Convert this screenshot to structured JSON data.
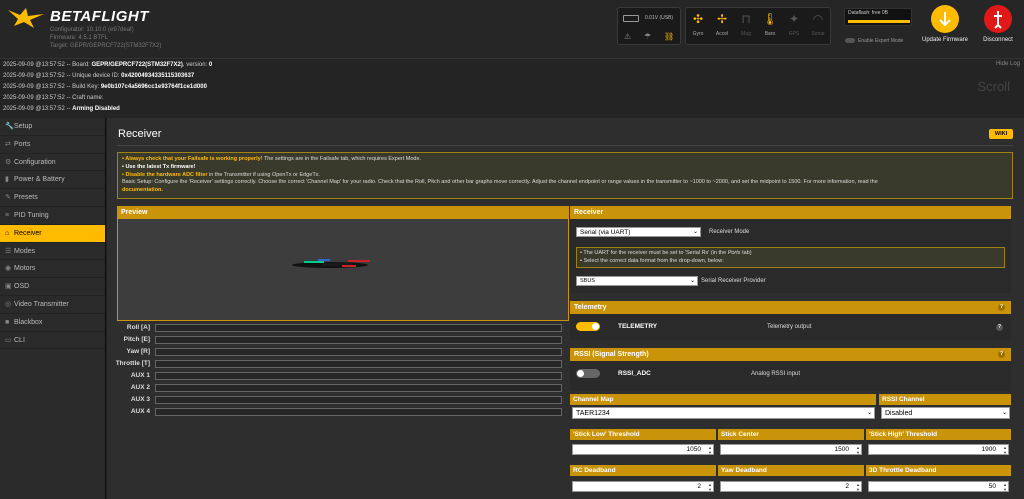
{
  "header": {
    "brand": "BETAFLIGHT",
    "configurator": "Configurator: 10.10.0 (e97deaf)",
    "firmware": "Firmware: 4.5.1 BTFL",
    "target": "Target: GEPR/GEPRCF722(STM32F7X2)",
    "battery_voltage": "0.01V (USB)",
    "sensors": [
      {
        "label": "Gyro",
        "icon": "gyro-icon",
        "active": true
      },
      {
        "label": "Accel",
        "icon": "accel-icon",
        "active": true
      },
      {
        "label": "Mag",
        "icon": "mag-icon",
        "active": false
      },
      {
        "label": "Baro",
        "icon": "baro-icon",
        "active": true
      },
      {
        "label": "GPS",
        "icon": "gps-icon",
        "active": false
      },
      {
        "label": "Sonar",
        "icon": "sonar-icon",
        "active": false
      }
    ],
    "dataflash": "Dataflash: free 0B",
    "expert_mode": "Enable Expert Mode",
    "update_firmware": "Update Firmware",
    "disconnect": "Disconnect",
    "accent": "#ffbb00"
  },
  "log": {
    "hide_label": "Hide Log",
    "scroll_label": "Scroll",
    "lines": [
      {
        "ts": "2025-09-09 @13:57:52",
        "text": " -- Board: ",
        "val": "GEPR/GEPRCF722(STM32F7X2)",
        "tail": ", version: ",
        "tailval": "0"
      },
      {
        "ts": "2025-09-09 @13:57:52",
        "text": " -- Unique device ID: ",
        "val": "0x42004934335115303637",
        "tail": "",
        "tailval": ""
      },
      {
        "ts": "2025-09-09 @13:57:52",
        "text": " -- Build Key: ",
        "val": "9e0b107c4a5696cc1e93764f1ce1d000",
        "tail": "",
        "tailval": ""
      },
      {
        "ts": "2025-09-09 @13:57:52",
        "text": " -- Craft name: ",
        "val": "",
        "tail": "",
        "tailval": ""
      },
      {
        "ts": "2025-09-09 @13:57:52",
        "text": " -- ",
        "val": "Arming Disabled",
        "tail": "",
        "tailval": ""
      }
    ]
  },
  "sidebar": {
    "items": [
      {
        "label": "Setup",
        "icon": "wrench-icon",
        "active": false
      },
      {
        "label": "Ports",
        "icon": "plug-icon",
        "active": false
      },
      {
        "label": "Configuration",
        "icon": "gear-icon",
        "active": false
      },
      {
        "label": "Power & Battery",
        "icon": "battery-icon",
        "active": false
      },
      {
        "label": "Presets",
        "icon": "wand-icon",
        "active": false
      },
      {
        "label": "PID Tuning",
        "icon": "sliders-icon",
        "active": false
      },
      {
        "label": "Receiver",
        "icon": "receiver-icon",
        "active": true
      },
      {
        "label": "Modes",
        "icon": "modes-icon",
        "active": false
      },
      {
        "label": "Motors",
        "icon": "motor-icon",
        "active": false
      },
      {
        "label": "OSD",
        "icon": "osd-icon",
        "active": false
      },
      {
        "label": "Video Transmitter",
        "icon": "vtx-icon",
        "active": false
      },
      {
        "label": "Blackbox",
        "icon": "blackbox-icon",
        "active": false
      },
      {
        "label": "CLI",
        "icon": "terminal-icon",
        "active": false
      }
    ]
  },
  "page": {
    "title": "Receiver",
    "wiki": "WIKI",
    "note": {
      "l1a": "• Always check that your Failsafe is working properly!",
      "l1b": " The settings are in the Failsafe tab, which requires Expert Mode.",
      "l2": "• Use the latest Tx firmware!",
      "l3a": "• Disable the hardware ADC filter",
      "l3b": " in the Transmitter if using OpenTx or EdgeTx.",
      "l4": "Basic Setup: Configure the 'Receiver' settings correctly. Choose the correct 'Channel Map' for your radio. Check that the Roll, Pitch and other bar graphs move correctly. Adjust the channel endpoint or range values in the transmitter to ~1000 to ~2000, and set the midpoint to 1500. For more information, read the",
      "l5": "documentation."
    },
    "preview_title": "Preview",
    "channels": [
      "Roll [A]",
      "Pitch [E]",
      "Yaw [R]",
      "Throttle [T]",
      "AUX 1",
      "AUX 2",
      "AUX 3",
      "AUX 4"
    ],
    "receiver": {
      "title": "Receiver",
      "mode_value": "Serial (via UART)",
      "mode_label": "Receiver Mode",
      "hint1a": "• The UART for the receiver must be set to 'Serial Rx' (in the ",
      "hint1b": "Ports",
      "hint1c": " tab)",
      "hint2": "• Select the correct data format from the drop-down, below:",
      "provider_value": "SBUS",
      "provider_label": "Serial Receiver Provider"
    },
    "telemetry": {
      "title": "Telemetry",
      "toggle_label": "TELEMETRY",
      "desc": "Telemetry output",
      "enabled": true
    },
    "rssi": {
      "title": "RSSI (Signal Strength)",
      "toggle_label": "RSSI_ADC",
      "desc": "Analog RSSI input",
      "enabled": false
    },
    "channel_map": {
      "title": "Channel Map",
      "value": "TAER1234"
    },
    "rssi_channel": {
      "title": "RSSI Channel",
      "value": "Disabled"
    },
    "stick_low": {
      "title": "'Stick Low' Threshold",
      "value": "1050"
    },
    "stick_center": {
      "title": "Stick Center",
      "value": "1500"
    },
    "stick_high": {
      "title": "'Stick High' Threshold",
      "value": "1900"
    },
    "rc_deadband": {
      "title": "RC Deadband",
      "value": "2"
    },
    "yaw_deadband": {
      "title": "Yaw Deadband",
      "value": "2"
    },
    "throttle_deadband": {
      "title": "3D Throttle Deadband",
      "value": "50"
    },
    "help": "?"
  }
}
